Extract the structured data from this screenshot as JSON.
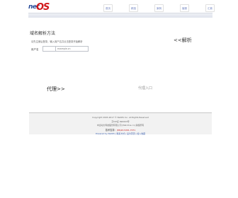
{
  "header": {
    "logo": {
      "part1": "net",
      "part2": "OS"
    },
    "nav": [
      "首页",
      "精选",
      "案例",
      "客服",
      "汇款"
    ]
  },
  "main": {
    "section_title": "域名解析方法",
    "hint": "请先注册后登录，输入用户名并点击登录开始解析",
    "field_label": "用户名",
    "input2_placeholder": "example.cn",
    "parse_button": "<<解析",
    "proxy_label": "代理>>",
    "proxy_entry": "代理入口"
  },
  "footer": {
    "copyright": "Copyright 2003-2017 © NetOS Inc. All Rights Reserved",
    "icp": "京ICP证 990003号",
    "company": "中企动力科技股份有限公司 (Net-Dns.cn) 版权所有",
    "phone_label": "技术支持：",
    "phone": "(86)20-5261-7071",
    "powered": "Powered by NetOS | 联系方式 | 设为首页 | 加入收藏"
  },
  "colors": {
    "logo_red": "#d2191b",
    "logo_blue": "#2a4d9a",
    "accent_red": "#c62020"
  }
}
